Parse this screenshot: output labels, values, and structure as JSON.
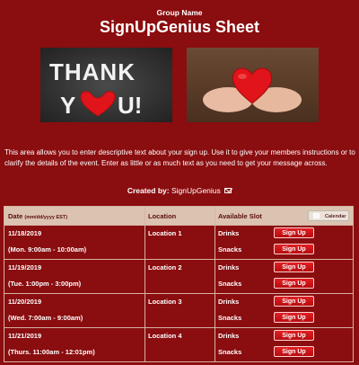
{
  "header": {
    "group_name": "Group Name",
    "sheet_title": "SignUpGenius Sheet"
  },
  "images": {
    "left_text": [
      "THANK",
      "Y",
      "U!"
    ],
    "colors": {
      "heart": "#e0141a",
      "background": "#8a0d0f"
    }
  },
  "description": "This area allows you to enter descriptive text about your sign up. Use it to give your members instructions or to clarify the details of the event. Enter as little or as much text as you need to get your message across.",
  "created_by": {
    "label": "Created by:",
    "name": "SignUpGenius"
  },
  "table": {
    "headers": {
      "date": "Date",
      "date_format": "(mm/dd/yyyy EST)",
      "location": "Location",
      "slot": "Available Slot",
      "calendar": "Calendar"
    },
    "rows": [
      {
        "date": "11/18/2019",
        "time": "(Mon. 9:00am - 10:00am)",
        "location": "Location 1",
        "slot1": "Drinks",
        "slot2": "Snacks",
        "btn": "Sign Up"
      },
      {
        "date": "11/19/2019",
        "time": "(Tue. 1:00pm - 3:00pm)",
        "location": "Location 2",
        "slot1": "Drinks",
        "slot2": "Snacks",
        "btn": "Sign Up"
      },
      {
        "date": "11/20/2019",
        "time": "(Wed. 7:00am - 9:00am)",
        "location": "Location 3",
        "slot1": "Drinks",
        "slot2": "Snacks",
        "btn": "Sign Up"
      },
      {
        "date": "11/21/2019",
        "time": "(Thurs. 11:00am - 12:01pm)",
        "location": "Location 4",
        "slot1": "Drinks",
        "slot2": "Snacks",
        "btn": "Sign Up"
      }
    ]
  }
}
